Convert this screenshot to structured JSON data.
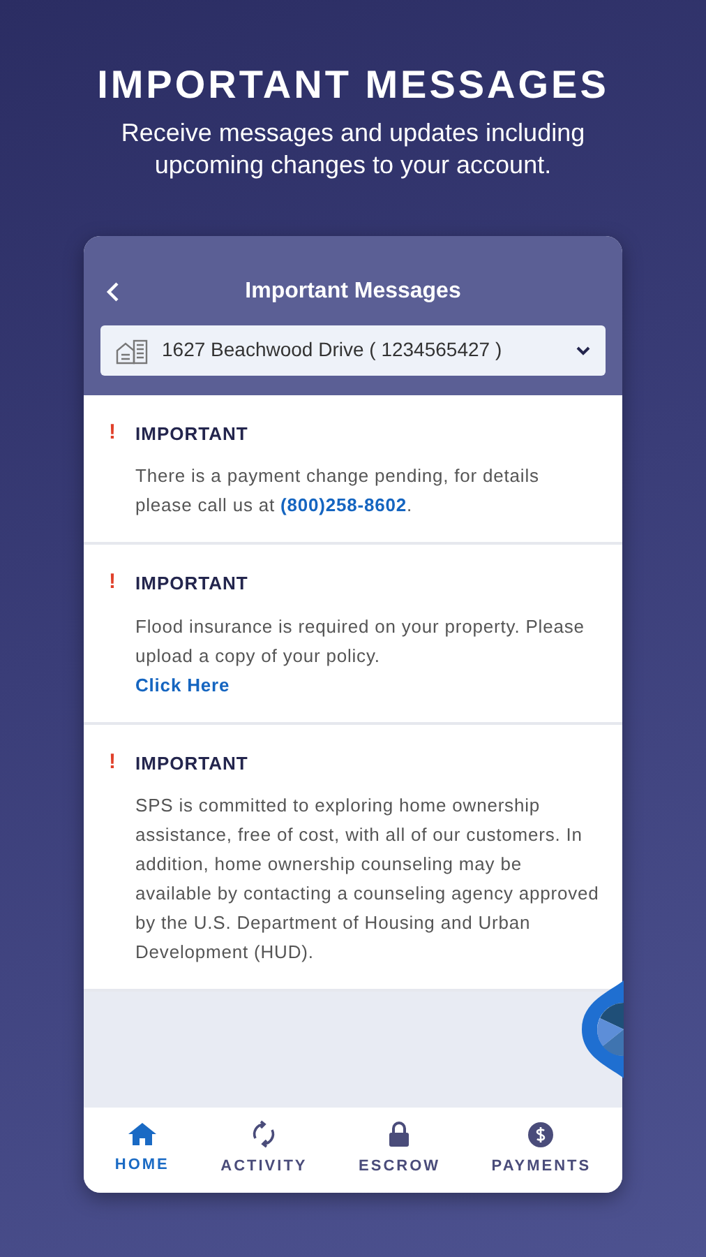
{
  "headline": "IMPORTANT MESSAGES",
  "subtitle": "Receive messages and updates including upcoming changes to your account.",
  "screen": {
    "title": "Important Messages",
    "account_select": {
      "value": "1627 Beachwood Drive ( 1234565427 )"
    },
    "messages": [
      {
        "marker": "!",
        "title": "IMPORTANT",
        "parts": [
          {
            "kind": "text",
            "text": "There is a payment change pending, for details please call us at "
          },
          {
            "kind": "link",
            "text": "(800)258-8602"
          },
          {
            "kind": "text",
            "text": "."
          }
        ]
      },
      {
        "marker": "!",
        "title": "IMPORTANT",
        "parts": [
          {
            "kind": "text",
            "text": "Flood insurance is required on your property. Please upload a copy of your policy."
          },
          {
            "kind": "link-line",
            "text": "Click Here"
          }
        ]
      },
      {
        "marker": "!",
        "title": "IMPORTANT",
        "parts": [
          {
            "kind": "text",
            "text": "SPS is committed to exploring home ownership assistance, free of cost, with all of our customers. In addition, home ownership counseling may be available by contacting a counseling agency approved by the U.S. Department of Housing and Urban Development (HUD)."
          }
        ]
      }
    ],
    "tabs": [
      {
        "kind": "home",
        "label": "HOME",
        "selected": true
      },
      {
        "kind": "activity",
        "label": "ACTIVITY",
        "selected": false
      },
      {
        "kind": "escrow",
        "label": "ESCROW",
        "selected": false
      },
      {
        "kind": "payments",
        "label": "PAYMENTS",
        "selected": false
      }
    ]
  }
}
